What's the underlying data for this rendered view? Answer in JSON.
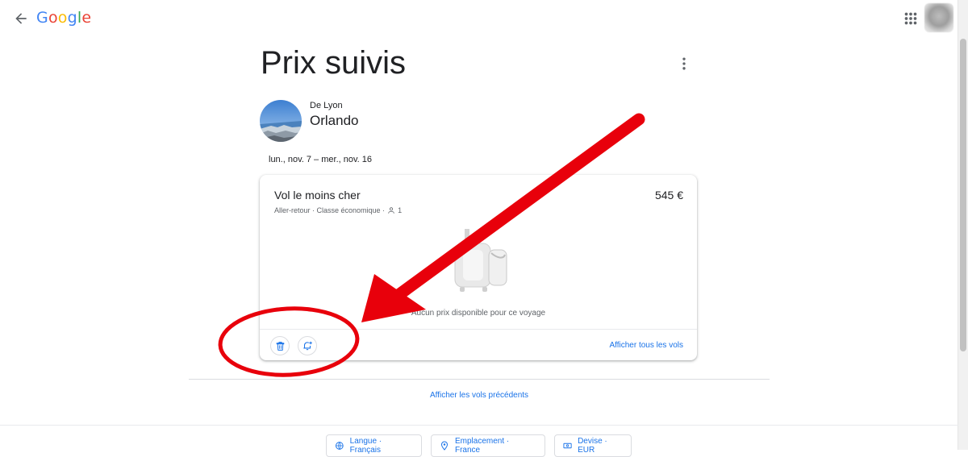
{
  "header": {
    "logo_text": "Google",
    "logo_colors": [
      "#4285F4",
      "#EA4335",
      "#FBBC05",
      "#4285F4",
      "#34A853",
      "#EA4335"
    ],
    "back_icon": "arrow-back-icon",
    "apps_icon": "apps-grid-icon"
  },
  "page": {
    "title": "Prix suivis",
    "more_icon": "more-vert-icon"
  },
  "trip": {
    "origin": "De Lyon",
    "destination": "Orlando",
    "dates": "lun., nov. 7 – mer., nov. 16"
  },
  "card": {
    "title": "Vol le moins cher",
    "price": "545 €",
    "meta": "Aller-retour · Classe économique ·",
    "passengers": "1",
    "empty_message": "Aucun prix disponible pour ce voyage",
    "show_all": "Afficher tous les vols",
    "delete_icon": "trash-icon",
    "alert_icon": "add-alert-icon"
  },
  "previous_link": "Afficher les vols précédents",
  "footer": {
    "language": "Langue · Français",
    "location": "Emplacement · France",
    "currency": "Devise · EUR"
  },
  "colors": {
    "link": "#1a73e8",
    "annotation": "#e8000b"
  }
}
